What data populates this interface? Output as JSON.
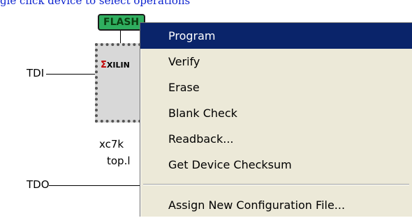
{
  "hint": "gle click device to select operations",
  "chain": {
    "tdi_label": "TDI",
    "tdo_label": "TDO",
    "flash_label": "FLASH",
    "chip_logo": "XILIN",
    "device_name": "xc7k",
    "device_file": "top.l"
  },
  "menu": {
    "items": [
      {
        "label": "Program",
        "selected": true
      },
      {
        "label": "Verify"
      },
      {
        "label": "Erase"
      },
      {
        "label": "Blank Check"
      },
      {
        "label": "Readback..."
      },
      {
        "label": "Get Device Checksum"
      },
      {
        "label": "Assign New Configuration File..."
      }
    ]
  },
  "colors": {
    "hint_text": "#0b22cf",
    "menu_selection": "#0a246a",
    "menu_background": "#ece9d8",
    "flash_fill": "#2fae5f"
  }
}
